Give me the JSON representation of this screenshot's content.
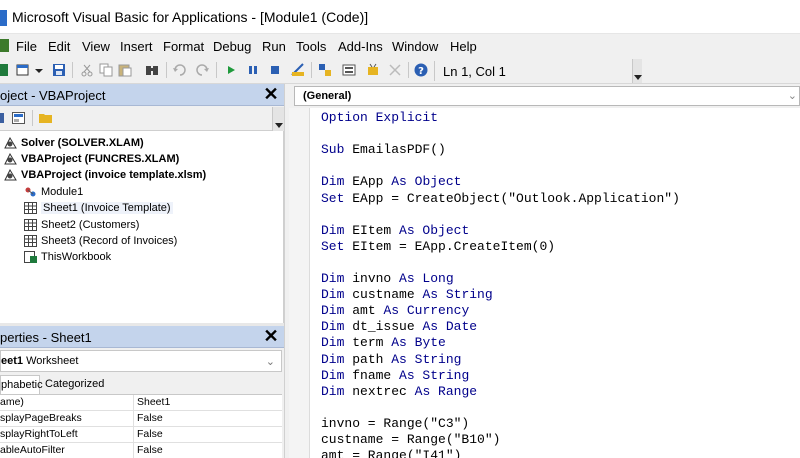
{
  "window": {
    "title": "Microsoft Visual Basic for Applications - [Module1 (Code)]"
  },
  "menu": [
    "File",
    "Edit",
    "View",
    "Insert",
    "Format",
    "Debug",
    "Run",
    "Tools",
    "Add-Ins",
    "Window",
    "Help"
  ],
  "toolbar": {
    "cursor_position": "Ln 1, Col 1"
  },
  "project_panel": {
    "title": "oject - VBAProject",
    "close_label": "✕",
    "tree": [
      {
        "label": "Solver (SOLVER.XLAM)",
        "level": 0,
        "bold": true,
        "icon": "vba-project-icon"
      },
      {
        "label": "VBAProject (FUNCRES.XLAM)",
        "level": 0,
        "bold": true,
        "icon": "vba-project-icon"
      },
      {
        "label": "VBAProject (invoice template.xlsm)",
        "level": 0,
        "bold": true,
        "icon": "vba-project-icon"
      },
      {
        "label": "Module1",
        "level": 1,
        "bold": false,
        "icon": "module-icon"
      },
      {
        "label": "Sheet1 (Invoice Template)",
        "level": 1,
        "bold": false,
        "icon": "worksheet-icon",
        "selected": true
      },
      {
        "label": "Sheet2 (Customers)",
        "level": 1,
        "bold": false,
        "icon": "worksheet-icon"
      },
      {
        "label": "Sheet3 (Record of Invoices)",
        "level": 1,
        "bold": false,
        "icon": "worksheet-icon"
      },
      {
        "label": "ThisWorkbook",
        "level": 1,
        "bold": false,
        "icon": "workbook-icon"
      }
    ]
  },
  "properties_panel": {
    "title": "perties - Sheet1",
    "close_label": "✕",
    "object_name": "eet1",
    "object_type": "Worksheet",
    "tabs": [
      "phabetic",
      "Categorized"
    ],
    "rows": [
      {
        "name": "ame)",
        "value": "Sheet1"
      },
      {
        "name": "splayPageBreaks",
        "value": "False"
      },
      {
        "name": "splayRightToLeft",
        "value": "False"
      },
      {
        "name": "ableAutoFilter",
        "value": "False"
      }
    ]
  },
  "code_window": {
    "object_dropdown": "(General)",
    "lines": [
      [
        {
          "t": "Option Explicit",
          "k": true
        }
      ],
      [],
      [
        {
          "t": "Sub ",
          "k": true
        },
        {
          "t": "EmailasPDF()"
        }
      ],
      [],
      [
        {
          "t": "Dim ",
          "k": true
        },
        {
          "t": "EApp "
        },
        {
          "t": "As Object",
          "k": true
        }
      ],
      [
        {
          "t": "Set ",
          "k": true
        },
        {
          "t": "EApp = CreateObject(\"Outlook.Application\")"
        }
      ],
      [],
      [
        {
          "t": "Dim ",
          "k": true
        },
        {
          "t": "EItem "
        },
        {
          "t": "As Object",
          "k": true
        }
      ],
      [
        {
          "t": "Set ",
          "k": true
        },
        {
          "t": "EItem = EApp.CreateItem(0)"
        }
      ],
      [],
      [
        {
          "t": "Dim ",
          "k": true
        },
        {
          "t": "invno "
        },
        {
          "t": "As Long",
          "k": true
        }
      ],
      [
        {
          "t": "Dim ",
          "k": true
        },
        {
          "t": "custname "
        },
        {
          "t": "As String",
          "k": true
        }
      ],
      [
        {
          "t": "Dim ",
          "k": true
        },
        {
          "t": "amt "
        },
        {
          "t": "As Currency",
          "k": true
        }
      ],
      [
        {
          "t": "Dim ",
          "k": true
        },
        {
          "t": "dt_issue "
        },
        {
          "t": "As Date",
          "k": true
        }
      ],
      [
        {
          "t": "Dim ",
          "k": true
        },
        {
          "t": "term "
        },
        {
          "t": "As Byte",
          "k": true
        }
      ],
      [
        {
          "t": "Dim ",
          "k": true
        },
        {
          "t": "path "
        },
        {
          "t": "As String",
          "k": true
        }
      ],
      [
        {
          "t": "Dim ",
          "k": true
        },
        {
          "t": "fname "
        },
        {
          "t": "As String",
          "k": true
        }
      ],
      [
        {
          "t": "Dim ",
          "k": true
        },
        {
          "t": "nextrec "
        },
        {
          "t": "As Range",
          "k": true
        }
      ],
      [],
      [
        {
          "t": "invno = Range(\"C3\")"
        }
      ],
      [
        {
          "t": "custname = Range(\"B10\")"
        }
      ],
      [
        {
          "t": "amt = Range(\"I41\")"
        }
      ]
    ]
  },
  "colors": {
    "keyword": "#00008b",
    "panel_header": "#c4d4ec",
    "accent": "#2b6cc8"
  }
}
